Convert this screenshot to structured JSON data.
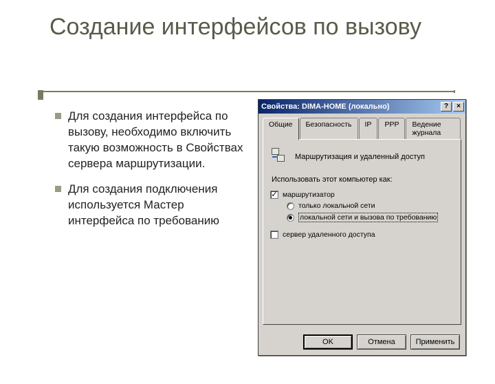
{
  "title": "Создание интерфейсов по вызову",
  "bullets": [
    "Для создания интерфейса по вызову, необходимо включить такую возможность в Свойствах сервера маршрутизации.",
    "Для создания подключения используется Мастер интерфейса по требованию"
  ],
  "dialog": {
    "titlebar": "Свойства: DIMA-HOME (локально)",
    "help_btn": "?",
    "close_btn": "×",
    "tabs": [
      "Общие",
      "Безопасность",
      "IP",
      "PPP",
      "Ведение журнала"
    ],
    "panel_title": "Маршрутизация и удаленный доступ",
    "subtitle": "Использовать этот компьютер как:",
    "router_label": "маршрутизатор",
    "radio_lan_only": "только локальной сети",
    "radio_lan_dial": "локальной сети и вызова по требованию",
    "remote_access_label": "сервер удаленного доступа",
    "ok": "OK",
    "cancel": "Отмена",
    "apply": "Применить"
  }
}
